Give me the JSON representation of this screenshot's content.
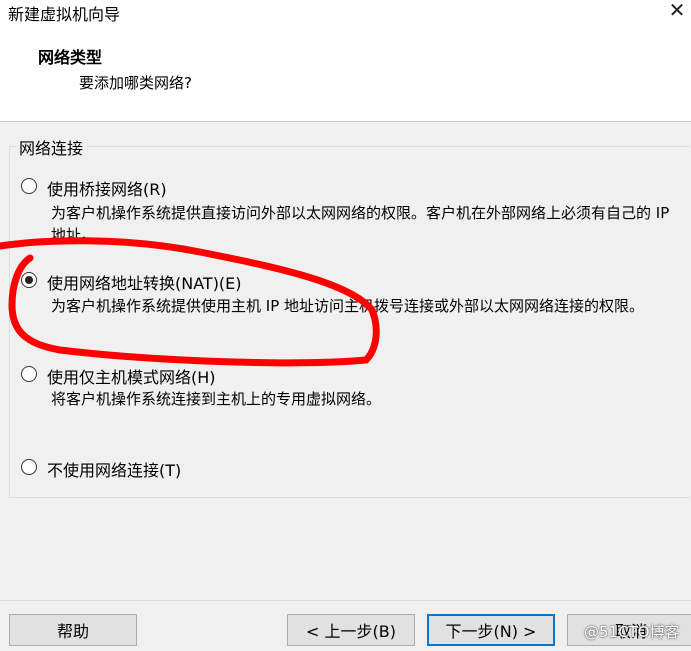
{
  "window": {
    "title": "新建虚拟机向导",
    "close_icon": "close-icon"
  },
  "header": {
    "title": "网络类型",
    "subtitle": "要添加哪类网络?"
  },
  "group": {
    "label": "网络连接",
    "options": [
      {
        "label": "使用桥接网络(R)",
        "description": "为客户机操作系统提供直接访问外部以太网网络的权限。客户机在外部网络上必须有自己的 IP 地址。",
        "selected": false
      },
      {
        "label": "使用网络地址转换(NAT)(E)",
        "description": "为客户机操作系统提供使用主机 IP 地址访问主机拨号连接或外部以太网网络连接的权限。",
        "selected": true
      },
      {
        "label": "使用仅主机模式网络(H)",
        "description": "将客户机操作系统连接到主机上的专用虚拟网络。",
        "selected": false
      },
      {
        "label": "不使用网络连接(T)",
        "description": "",
        "selected": false
      }
    ]
  },
  "buttons": {
    "help": "帮助",
    "back": "< 上一步(B)",
    "next": "下一步(N) >",
    "cancel": "取消"
  },
  "watermark": "@51CTO博客",
  "annotation_color": "#ff0000"
}
